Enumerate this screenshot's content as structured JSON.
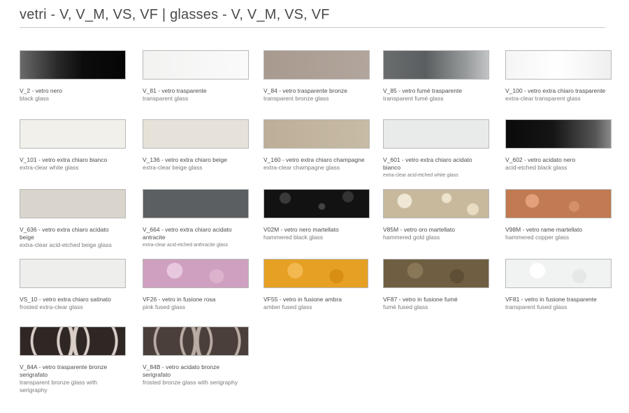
{
  "header": {
    "title": "vetri - V, V_M, VS, VF | glasses - V, V_M, VS, VF"
  },
  "swatches": [
    {
      "code": "V_2 - vetro nero",
      "en": "black glass",
      "fill": "linear-gradient(90deg,#6a6a6a 0%,#2a2a2a 35%,#0c0c0c 60%,#050505 100%)"
    },
    {
      "code": "V_81 - vetro trasparente",
      "en": "transparent glass",
      "fill": "linear-gradient(90deg,#f2f3f1,#fafafa)"
    },
    {
      "code": "V_84 - vetro trasparente bronze",
      "en": "transparent bronze glass",
      "fill": "linear-gradient(90deg,#a89a8f,#b2a59b)"
    },
    {
      "code": "V_85 - vetro fumé trasparente",
      "en": "transparent fumé glass",
      "fill": "linear-gradient(90deg,#6a6d6e 0%,#5a5e60 40%,#9a9d9e 80%,#c2c4c5 100%)"
    },
    {
      "code": "V_100 - vetro extra chiaro trasparente",
      "en": "extra-clear transparent glass",
      "fill": "linear-gradient(90deg,#f4f5f4,#ffffff,#eeefee)"
    },
    {
      "code": "V_101 - vetro extra chiaro bianco",
      "en": "extra-clear white glass",
      "fill": "#f1f0ea"
    },
    {
      "code": "V_136 - vetro extra chiaro beige",
      "en": "extra-clear beige glass",
      "fill": "#e6e2d9"
    },
    {
      "code": "V_160 - vetro extra chiaro champagne",
      "en": "extra-clear champagne glass",
      "fill": "linear-gradient(90deg,#bcae97,#c8bba5)"
    },
    {
      "code": "V_601 - vetro extra chiaro acidato bianco",
      "en": "extra-clear acid-etched white glass",
      "fill": "#e9ebeb",
      "small": true
    },
    {
      "code": "V_602 - vetro acidato nero",
      "en": "acid-etched black glass",
      "fill": "linear-gradient(90deg,#0a0a0a 0%,#151515 45%,#555 85%,#8a8a8a 100%)"
    },
    {
      "code": "V_636 - vetro extra chiaro acidato beige",
      "en": "extra-clear acid-etched beige glass",
      "fill": "#d9d5cc"
    },
    {
      "code": "V_664 - vetro extra chiaro acidato antracite",
      "en": "extra-clear acid-etched anthracite glass",
      "fill": "#5c5f61",
      "small": true
    },
    {
      "code": "V02M - vetro nero martellato",
      "en": "hammered black glass",
      "fill": "radial-gradient(circle at 20% 30%,#3a3a3a 0 6%,transparent 7%),radial-gradient(circle at 55% 60%,#444 0 5%,transparent 6%),radial-gradient(circle at 80% 25%,#333 0 6%,transparent 7%),#121212"
    },
    {
      "code": "V85M - vetro oro martellato",
      "en": "hammered gold glass",
      "fill": "radial-gradient(circle at 20% 40%,#f0e8d6 0 8%,transparent 9%),radial-gradient(circle at 60% 30%,#eee3cc 0 7%,transparent 8%),radial-gradient(circle at 85% 70%,#e8dcc3 0 6%,transparent 7%),#c8b99c"
    },
    {
      "code": "V98M - vetro rame martellato",
      "en": "hammered copper glass",
      "fill": "radial-gradient(circle at 25% 40%,#e3a07a 0 8%,transparent 9%),radial-gradient(circle at 65% 60%,#d69068 0 7%,transparent 8%),#c27a52"
    },
    {
      "code": "VS_10 - vetro extra chiaro satinato",
      "en": "frosted extra-clear glass",
      "fill": "#eeeeec"
    },
    {
      "code": "VF26 - vetro in fusione rosa",
      "en": "pink fused glass",
      "fill": "radial-gradient(circle at 30% 40%,#e8c8de 0 10%,transparent 11%),radial-gradient(circle at 70% 60%,#dcb2cc 0 9%,transparent 10%),#cfa0bf"
    },
    {
      "code": "VF55 - vetro in fusione ambra",
      "en": "amber fused glass",
      "fill": "radial-gradient(circle at 30% 40%,#f3b850 0 10%,transparent 11%),radial-gradient(circle at 70% 60%,#d88e12 0 9%,transparent 10%),#e6a024"
    },
    {
      "code": "VF87 - vetro in fusione fumé",
      "en": "fumé fused glass",
      "fill": "radial-gradient(circle at 30% 40%,#8a7758 0 10%,transparent 11%),radial-gradient(circle at 70% 60%,#5e4f36 0 9%,transparent 10%),#6f5e42"
    },
    {
      "code": "VF81 - vetro in fusione trasparente",
      "en": "transparent fused glass",
      "fill": "radial-gradient(circle at 30% 40%,#ffffff 0 10%,transparent 11%),radial-gradient(circle at 70% 60%,#e6e8e8 0 9%,transparent 10%),#f1f2f2"
    },
    {
      "code": "V_84A - vetro trasparente bronze serigrafato",
      "en": "transparent bronze glass with serigraphy",
      "fill": "radial-gradient(circle at 12% 50%,transparent 0 40%,#d9cfc8 41% 44%,transparent 45%),radial-gradient(circle at 38% 50%,transparent 0 40%,#d9cfc8 41% 44%,transparent 45%),radial-gradient(circle at 64% 50%,transparent 0 40%,#d9cfc8 41% 44%,transparent 45%),radial-gradient(circle at 90% 50%,transparent 0 40%,#d9cfc8 41% 44%,transparent 45%),#2f2724"
    },
    {
      "code": "V_84B - vetro acidato bronze serigrafato",
      "en": "frosted bronze glass with serigraphy",
      "fill": "radial-gradient(circle at 12% 50%,transparent 0 40%,#b8aca4 41% 44%,transparent 45%),radial-gradient(circle at 38% 50%,transparent 0 40%,#b8aca4 41% 44%,transparent 45%),radial-gradient(circle at 64% 50%,transparent 0 40%,#b8aca4 41% 44%,transparent 45%),radial-gradient(circle at 90% 50%,transparent 0 40%,#b8aca4 41% 44%,transparent 45%),#4a3f3a"
    }
  ]
}
